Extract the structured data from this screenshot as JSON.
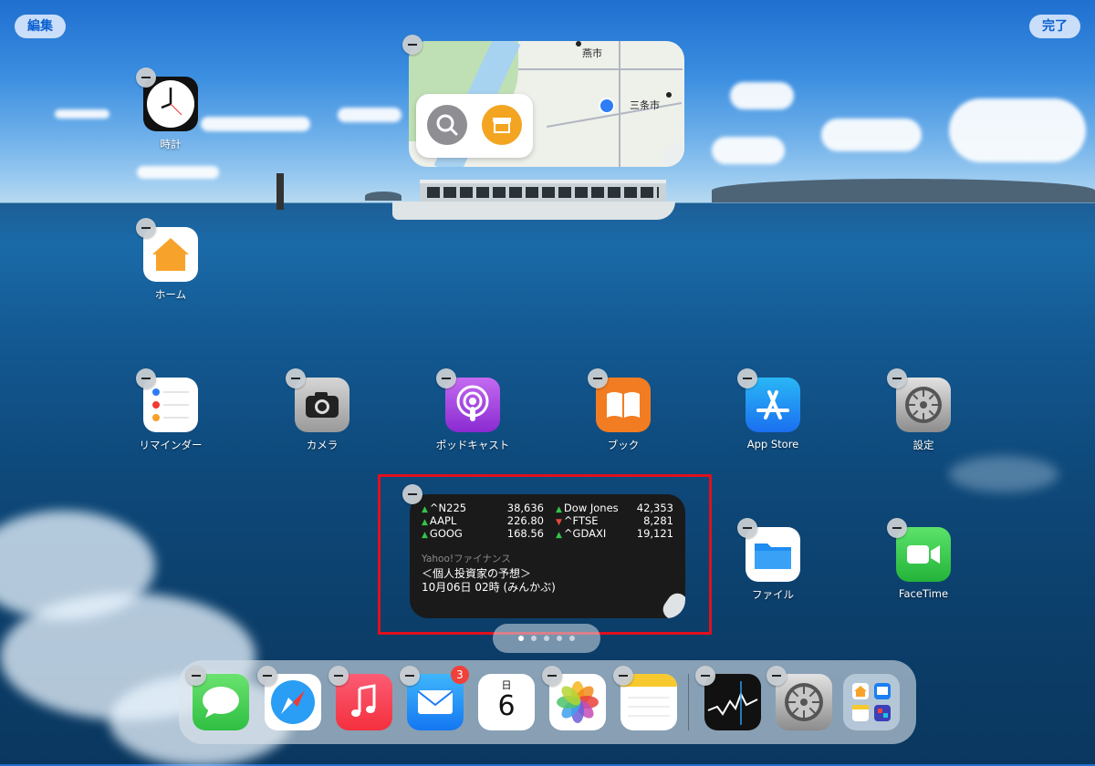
{
  "top_bar": {
    "edit_label": "編集",
    "done_label": "完了"
  },
  "map_widget": {
    "cities": [
      "燕市",
      "三条市"
    ]
  },
  "apps": [
    {
      "id": "clock",
      "label": "時計"
    },
    {
      "id": "home",
      "label": "ホーム"
    },
    {
      "id": "reminders",
      "label": "リマインダー"
    },
    {
      "id": "camera",
      "label": "カメラ"
    },
    {
      "id": "podcasts",
      "label": "ポッドキャスト"
    },
    {
      "id": "books",
      "label": "ブック"
    },
    {
      "id": "appstore",
      "label": "App Store"
    },
    {
      "id": "settings",
      "label": "設定"
    },
    {
      "id": "files",
      "label": "ファイル"
    },
    {
      "id": "facetime",
      "label": "FaceTime"
    }
  ],
  "stocks_widget": {
    "left": [
      {
        "name": "^N225",
        "value": "38,636",
        "trend": "up"
      },
      {
        "name": "AAPL",
        "value": "226.80",
        "trend": "up"
      },
      {
        "name": "GOOG",
        "value": "168.56",
        "trend": "up"
      }
    ],
    "right": [
      {
        "name": "Dow Jones",
        "value": "42,353",
        "trend": "up"
      },
      {
        "name": "^FTSE",
        "value": "8,281",
        "trend": "down"
      },
      {
        "name": "^GDAXI",
        "value": "19,121",
        "trend": "up"
      }
    ],
    "source": "Yahoo!ファイナンス",
    "headline_1": "＜個人投資家の予想＞",
    "headline_2": "10月06日 02時 (みんかぶ)"
  },
  "dock": {
    "mail_badge": "3",
    "calendar_weekday": "日",
    "calendar_day": "6",
    "apps": [
      "messages-icon",
      "safari-icon",
      "music-icon",
      "mail-icon",
      "calendar-icon",
      "photos-icon",
      "notes-icon",
      "stocks-icon",
      "settings-icon",
      "app-library-icon"
    ]
  },
  "colors": {
    "highlight": "#e0101e",
    "accent": "#0a5fd1"
  }
}
